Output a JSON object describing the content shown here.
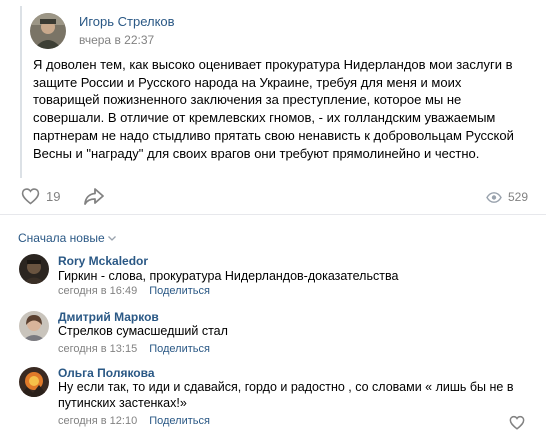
{
  "post": {
    "author_name": "Игорь Стрелков",
    "time": "вчера в 22:37",
    "text": "Я доволен тем, как высоко оценивает прокуратура Нидерландов мои заслуги в защите России и Русского народа на Украине, требуя для меня и моих товарищей пожизненного заключения за преступление, которое мы не совершали. В отличие от кремлевских гномов, - их голландским уважаемым партнерам не надо стыдливо прятать свою ненависть к добровольцам Русской Весны и \"награду\" для своих врагов они требуют прямолинейно и честно.",
    "likes": "19",
    "views": "529",
    "like_icon": "heart-outline-icon",
    "share_icon": "share-arrow-icon",
    "views_icon": "eye-icon"
  },
  "comments_header": {
    "sort_label": "Сначала новые",
    "sort_icon": "chevron-down-icon"
  },
  "comments": [
    {
      "author": "Rory Mckaledor",
      "text": "Гиркин - слова, прокуратура Нидерландов-доказательства",
      "time": "сегодня в 16:49",
      "reply": "Поделиться"
    },
    {
      "author": "Дмитрий Марков",
      "text": "Стрелков сумасшедший стал",
      "time": "сегодня в 13:15",
      "reply": "Поделиться"
    },
    {
      "author": "Ольга Полякова",
      "text": "Ну если так, то иди и сдавайся, гордо и радостно , со словами « лишь бы не в путинских застенках!»",
      "time": "сегодня в 12:10",
      "reply": "Поделиться"
    }
  ],
  "colors": {
    "link": "#2a5885",
    "muted": "#828282",
    "divider": "#e7e8ec",
    "quote_bar": "#dce1e6"
  }
}
